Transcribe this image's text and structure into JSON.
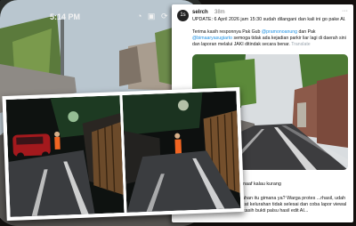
{
  "phone": {
    "status_time": "5:14 PM",
    "status_icons": "◔ ▣ ⟳"
  },
  "tweet": {
    "avatar_initials": "1s",
    "handle": "selrch",
    "time": "38m",
    "more_glyph": "···",
    "update": "UPDATE: 6 April 2026 jam 15:30 sudah dilangani dan kali ini go pake Al.",
    "text_parts": [
      "Terima kasih responnya Pak Gub ",
      "@pramonoanung",
      " dan Pak ",
      "@bimaaryasugiarto",
      " semoga tidak ada kejadian parkir liar lagi di daerah sini dan laporan melalui JAKI ditindak secara benar. ",
      "Translate"
    ],
    "reply1": "...pertanya, maaf kalau kurang",
    "reply2": "...jalan kelurahan itu gimana ya? Warga protes ...rhasil, udah lapor ke lingkat kelurahan tidak selesai dan coba lapor viewal jaki malah dikasih bukti palsu hasil edit AI..."
  },
  "colors": {
    "link": "#1d8fe1",
    "avatar_bg": "#222222",
    "worker_orange": "#f26522",
    "car_red": "#a3191d",
    "road_marking": "#f4f4f4"
  }
}
